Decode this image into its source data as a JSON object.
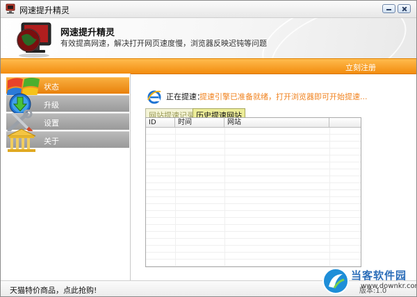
{
  "window": {
    "title": "网速提升精灵"
  },
  "header": {
    "title": "网速提升精灵",
    "subtitle": "有效提高网速，解决打开网页速度慢，浏览器反映迟钝等问题"
  },
  "toolbar": {
    "register_label": "立刻注册"
  },
  "sidebar": {
    "items": [
      {
        "label": "状态",
        "active": true
      },
      {
        "label": "升级",
        "active": false
      },
      {
        "label": "设置",
        "active": false
      },
      {
        "label": "关于",
        "active": false
      }
    ]
  },
  "status": {
    "label": "正在提速：",
    "message": "提速引擎已准备就绪，打开浏览器即可开始提速..."
  },
  "tabs": [
    {
      "label": "网站提速记录",
      "active": false
    },
    {
      "label": "历史提速网站",
      "active": true
    }
  ],
  "table": {
    "columns": [
      "ID",
      "时间",
      "网站",
      ""
    ],
    "rows": []
  },
  "statusbar": {
    "promo": "天猫特价商品，点此抢购!",
    "version": "版本:1.0"
  },
  "watermark": {
    "title": "当客软件园",
    "url": "www.downkr.com"
  },
  "colors": {
    "accent": "#f28c0e",
    "status_message": "#f0821e",
    "watermark": "#2b6db8"
  }
}
